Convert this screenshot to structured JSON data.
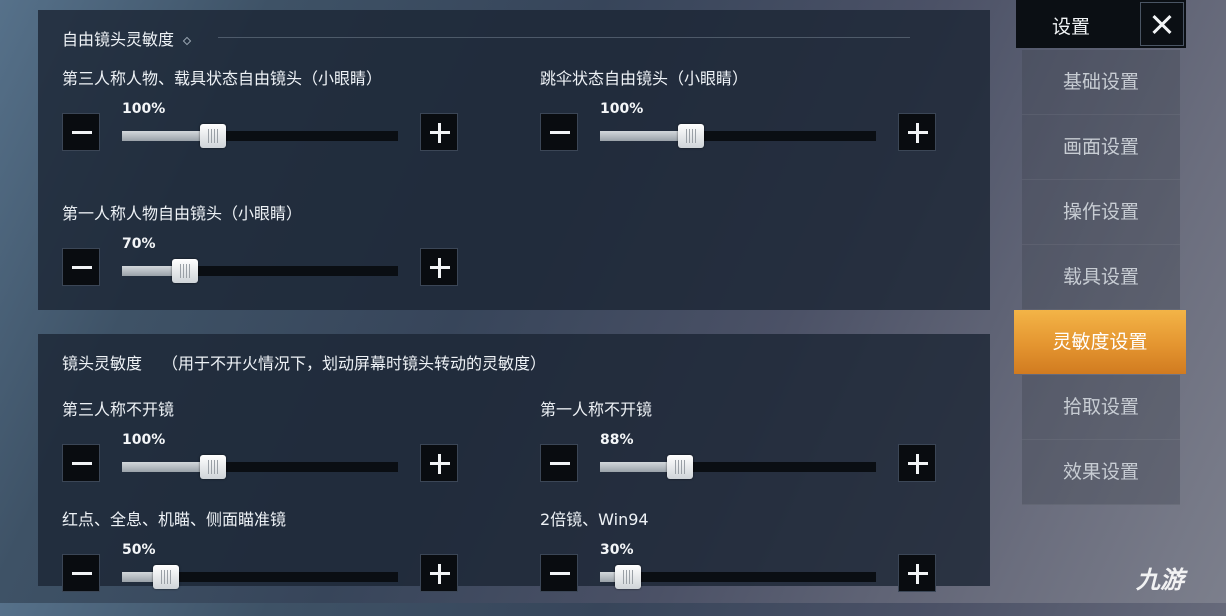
{
  "colors": {
    "accent": "#e8993a",
    "panel_bg": "#1c2634",
    "button_bg": "#090c10",
    "text": "#eef2f6",
    "menu_text": "#c7ccd3"
  },
  "free_look": {
    "title": "自由镜头灵敏度",
    "settings": [
      {
        "label": "第三人称人物、载具状态自由镜头（小眼睛）",
        "value_text": "100%",
        "level": 0.33
      },
      {
        "label": "跳伞状态自由镜头（小眼睛）",
        "value_text": "100%",
        "level": 0.33
      },
      {
        "label": "第一人称人物自由镜头（小眼睛）",
        "value_text": "70%",
        "level": 0.23
      }
    ]
  },
  "camera": {
    "title": "镜头灵敏度",
    "note": "（用于不开火情况下，划动屏幕时镜头转动的灵敏度）",
    "settings": [
      {
        "label": "第三人称不开镜",
        "value_text": "100%",
        "level": 0.33
      },
      {
        "label": "第一人称不开镜",
        "value_text": "88%",
        "level": 0.29
      },
      {
        "label": "红点、全息、机瞄、侧面瞄准镜",
        "value_text": "50%",
        "level": 0.16
      },
      {
        "label": "2倍镜、Win94",
        "value_text": "30%",
        "level": 0.1
      }
    ]
  },
  "buttons": {
    "minus_icon": "minus-icon",
    "plus_icon": "plus-icon",
    "close_icon": "close-icon"
  },
  "menu": {
    "title": "设置",
    "items": [
      {
        "label": "基础设置",
        "active": false
      },
      {
        "label": "画面设置",
        "active": false
      },
      {
        "label": "操作设置",
        "active": false
      },
      {
        "label": "载具设置",
        "active": false
      },
      {
        "label": "灵敏度设置",
        "active": true
      },
      {
        "label": "拾取设置",
        "active": false
      },
      {
        "label": "效果设置",
        "active": false
      }
    ]
  },
  "watermark": "九游"
}
